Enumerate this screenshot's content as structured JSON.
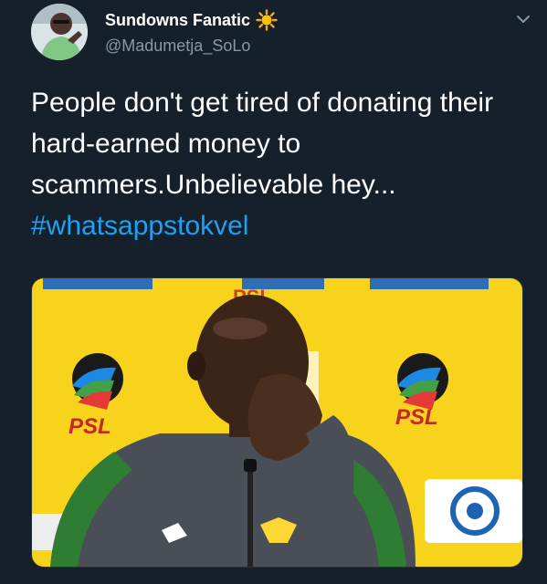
{
  "tweet": {
    "author": {
      "display_name": "Sundowns Fanatic",
      "handle": "@Madumetja_SoLo"
    },
    "text": "People don't get tired of donating their hard-earned money to scammers.Unbelievable hey...",
    "hashtag": "#whatsappstokvel",
    "media": {
      "backdrop_logo_text": "PSL",
      "colors": {
        "backdrop": "#f7d31c",
        "jacket": "#4a4f57",
        "sleeve_stripe": "#2e7d32",
        "skin": "#3b2418"
      }
    }
  },
  "colors": {
    "background": "#15202b",
    "text": "#ffffff",
    "secondary_text": "#8899a6",
    "link": "#1da1f2"
  },
  "icons": {
    "verified_emoji": "sun-emoji-icon",
    "menu": "chevron-down-icon"
  }
}
